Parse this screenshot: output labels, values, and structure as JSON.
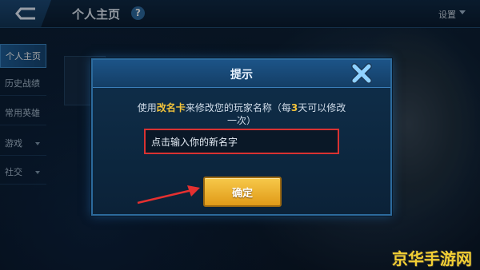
{
  "header": {
    "title": "个人主页",
    "help_icon": "?",
    "settings_label": "设置"
  },
  "sidebar": {
    "items": [
      {
        "label": "个人主页",
        "active": true
      },
      {
        "label": "历史战绩",
        "active": false
      },
      {
        "label": "常用英雄",
        "active": false
      },
      {
        "label": "游戏",
        "active": false,
        "has_caret": true
      },
      {
        "label": "社交",
        "active": false,
        "has_caret": true
      }
    ]
  },
  "dialog": {
    "title": "提示",
    "message_parts": [
      "使用",
      "改名卡",
      "来修改您的玩家名称（每",
      "3",
      "天可以修改一次）"
    ],
    "input_placeholder": "点击输入你的新名字",
    "confirm_label": "确定",
    "close_icon": "close-x-icon"
  },
  "colors": {
    "accent": "#f2c33b",
    "highlight_border": "#d93232",
    "confirm": "#f0b432"
  },
  "watermark": "京华手游网"
}
